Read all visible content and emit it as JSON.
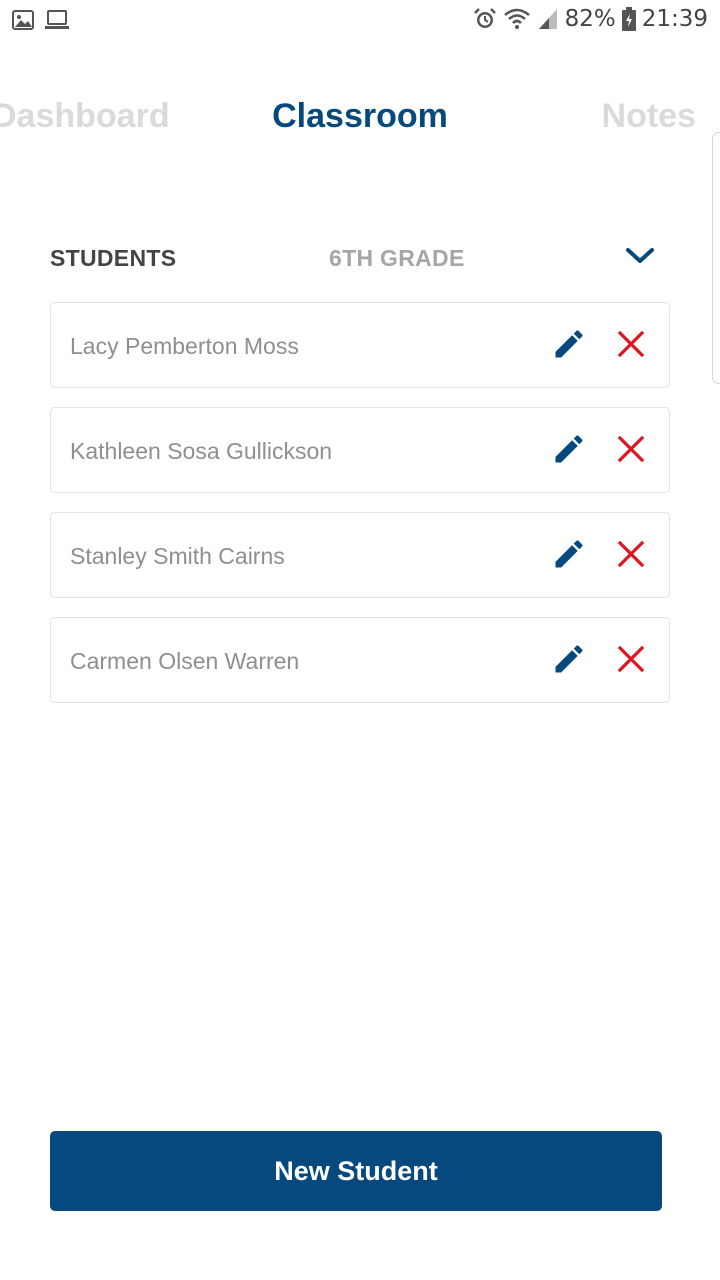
{
  "status_bar": {
    "left_icons": [
      "gallery-icon",
      "laptop-icon"
    ],
    "right_icons": [
      "alarm-icon",
      "wifi-icon",
      "signal-icon"
    ],
    "battery_percent": "82%",
    "battery_icon": "battery-icon",
    "time": "21:39"
  },
  "tabs": [
    {
      "label": "Dashboard",
      "active": false
    },
    {
      "label": "Classroom",
      "active": true
    },
    {
      "label": "Notes",
      "active": false
    }
  ],
  "section": {
    "title": "STUDENTS",
    "grade": "6TH GRADE",
    "toggle_icon": "chevron-down-icon"
  },
  "students": [
    {
      "name": "Lacy Pemberton Moss"
    },
    {
      "name": "Kathleen Sosa Gullickson"
    },
    {
      "name": "Stanley Smith Cairns"
    },
    {
      "name": "Carmen Olsen Warren"
    }
  ],
  "row_icons": {
    "edit": "pencil-icon",
    "delete": "close-icon"
  },
  "new_student_button": {
    "label": "New Student"
  },
  "colors": {
    "primary": "#05497e",
    "delete": "#e0141e",
    "inactive_tab": "#dadada",
    "muted_text": "#8f8f8f",
    "border": "#e2e2e2"
  }
}
